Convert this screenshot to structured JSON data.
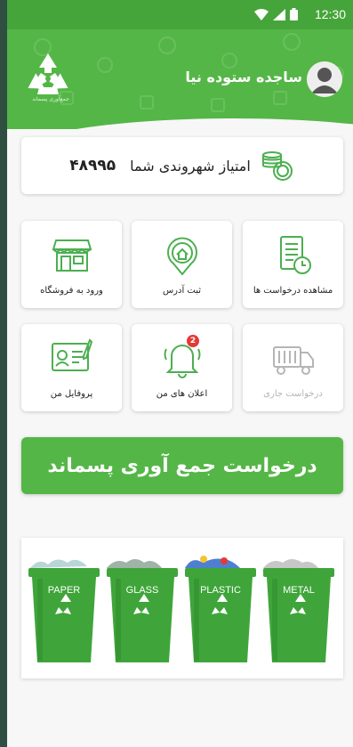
{
  "status_bar": {
    "time": "12:30"
  },
  "header": {
    "user_name": "ساجده ستوده نیا",
    "logo_caption": "جمع‌آوری پسماند"
  },
  "score": {
    "label": "امتیاز شهروندی شما",
    "value": "۴۸۹۹۵"
  },
  "tiles": [
    {
      "label": "مشاهده درخواست ها",
      "icon": "requests-list-icon",
      "enabled": true
    },
    {
      "label": "ثبت آدرس",
      "icon": "location-pin-icon",
      "enabled": true
    },
    {
      "label": "ورود به فروشگاه",
      "icon": "store-icon",
      "enabled": true
    },
    {
      "label": "درخواست جاری",
      "icon": "garbage-truck-icon",
      "enabled": false
    },
    {
      "label": "اعلان های من",
      "icon": "notification-bell-icon",
      "enabled": true,
      "badge": "2"
    },
    {
      "label": "پروفایل من",
      "icon": "profile-card-icon",
      "enabled": true
    }
  ],
  "cta": {
    "label": "درخواست جمع آوری پسماند"
  },
  "banner": {
    "bins": [
      "PAPER",
      "GLASS",
      "PLASTIC",
      "METAL"
    ]
  },
  "colors": {
    "primary": "#54b646",
    "status_bar": "#46a53a",
    "icon_green": "#4caf50",
    "badge": "#e53935"
  }
}
